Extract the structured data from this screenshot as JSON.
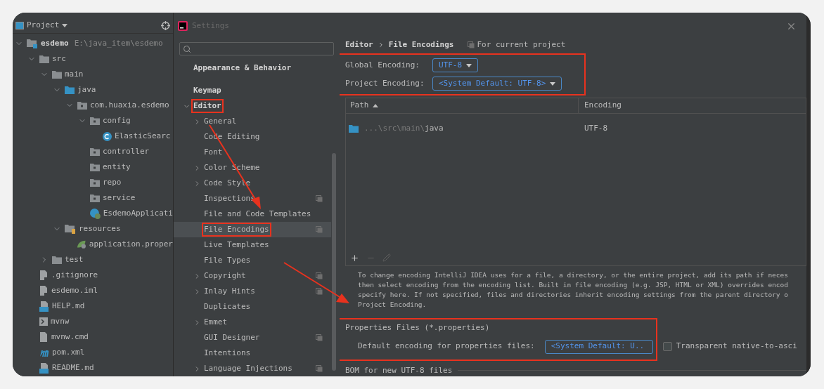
{
  "project_panel": {
    "title": "Project",
    "tree": [
      {
        "label": "esdemo",
        "kind": "module",
        "path": "E:\\java_item\\esdemo",
        "expanded": true,
        "children": [
          {
            "label": "src",
            "kind": "folder",
            "expanded": true,
            "children": [
              {
                "label": "main",
                "kind": "folder",
                "expanded": true,
                "children": [
                  {
                    "label": "java",
                    "kind": "source",
                    "expanded": true,
                    "children": [
                      {
                        "label": "com.huaxia.esdemo",
                        "kind": "package",
                        "expanded": true,
                        "children": [
                          {
                            "label": "config",
                            "kind": "package",
                            "expanded": true,
                            "children": [
                              {
                                "label": "ElasticSearc",
                                "kind": "class"
                              }
                            ]
                          },
                          {
                            "label": "controller",
                            "kind": "package"
                          },
                          {
                            "label": "entity",
                            "kind": "package"
                          },
                          {
                            "label": "repo",
                            "kind": "package"
                          },
                          {
                            "label": "service",
                            "kind": "package"
                          },
                          {
                            "label": "EsdemoApplicati",
                            "kind": "app-class"
                          }
                        ]
                      }
                    ]
                  },
                  {
                    "label": "resources",
                    "kind": "resources",
                    "expanded": true,
                    "children": [
                      {
                        "label": "application.proper",
                        "kind": "properties"
                      }
                    ]
                  }
                ]
              },
              {
                "label": "test",
                "kind": "folder",
                "expanded": false
              }
            ]
          },
          {
            "label": ".gitignore",
            "kind": "ignore"
          },
          {
            "label": "esdemo.iml",
            "kind": "iml"
          },
          {
            "label": "HELP.md",
            "kind": "markdown"
          },
          {
            "label": "mvnw",
            "kind": "shell"
          },
          {
            "label": "mvnw.cmd",
            "kind": "text"
          },
          {
            "label": "pom.xml",
            "kind": "maven"
          },
          {
            "label": "README.md",
            "kind": "markdown"
          }
        ]
      }
    ]
  },
  "settings": {
    "title": "Settings",
    "nav": [
      {
        "label": "Appearance & Behavior",
        "expandable": false,
        "selected": false,
        "annotated": false
      },
      {
        "label": "Keymap",
        "expandable": false,
        "selected": false,
        "annotated": false
      },
      {
        "label": "Editor",
        "expandable": true,
        "expanded": true,
        "selected": false,
        "annotated": true,
        "children": [
          {
            "label": "General",
            "expandable": true,
            "project_scope": false,
            "selected": false,
            "annotated": false
          },
          {
            "label": "Code Editing",
            "expandable": false,
            "project_scope": false,
            "selected": false,
            "annotated": false
          },
          {
            "label": "Font",
            "expandable": false,
            "project_scope": false,
            "selected": false,
            "annotated": false
          },
          {
            "label": "Color Scheme",
            "expandable": true,
            "project_scope": false,
            "selected": false,
            "annotated": false
          },
          {
            "label": "Code Style",
            "expandable": true,
            "project_scope": false,
            "selected": false,
            "annotated": false
          },
          {
            "label": "Inspections",
            "expandable": false,
            "project_scope": true,
            "selected": false,
            "annotated": false
          },
          {
            "label": "File and Code Templates",
            "expandable": false,
            "project_scope": false,
            "selected": false,
            "annotated": false
          },
          {
            "label": "File Encodings",
            "expandable": false,
            "project_scope": true,
            "selected": true,
            "annotated": true
          },
          {
            "label": "Live Templates",
            "expandable": false,
            "project_scope": false,
            "selected": false,
            "annotated": false
          },
          {
            "label": "File Types",
            "expandable": false,
            "project_scope": false,
            "selected": false,
            "annotated": false
          },
          {
            "label": "Copyright",
            "expandable": true,
            "project_scope": true,
            "selected": false,
            "annotated": false
          },
          {
            "label": "Inlay Hints",
            "expandable": true,
            "project_scope": true,
            "selected": false,
            "annotated": false
          },
          {
            "label": "Duplicates",
            "expandable": false,
            "project_scope": false,
            "selected": false,
            "annotated": false
          },
          {
            "label": "Emmet",
            "expandable": true,
            "project_scope": false,
            "selected": false,
            "annotated": false
          },
          {
            "label": "GUI Designer",
            "expandable": false,
            "project_scope": true,
            "selected": false,
            "annotated": false
          },
          {
            "label": "Intentions",
            "expandable": false,
            "project_scope": false,
            "selected": false,
            "annotated": false
          },
          {
            "label": "Language Injections",
            "expandable": true,
            "project_scope": true,
            "selected": false,
            "annotated": false
          }
        ]
      }
    ],
    "breadcrumb": [
      "Editor",
      "File Encodings"
    ],
    "scope": "For current project",
    "encodings": {
      "annotated": true,
      "global_label": "Global Encoding:",
      "global_value": "UTF-8",
      "project_label": "Project Encoding:",
      "project_value": "<System Default: UTF-8>"
    },
    "table": {
      "columns": [
        {
          "label": "Path",
          "sorted_ascending": true
        },
        {
          "label": "Encoding"
        }
      ],
      "rows": [
        {
          "path_prefix": "...\\src\\main\\",
          "path_name": "java",
          "encoding": "UTF-8"
        }
      ]
    },
    "description": [
      "To change encoding IntelliJ IDEA uses for a file, a directory, or the entire project, add its path if neces",
      "then select encoding from the encoding list. Built in file encoding (e.g. JSP, HTML or XML) overrides encod",
      "specify here. If not specified, files and directories inherit encoding settings from the parent directory o",
      "Project Encoding."
    ],
    "properties": {
      "annotated": true,
      "title": "Properties Files (*.properties)",
      "label": "Default encoding for properties files:",
      "value": "<System Default: U..",
      "transparent_label": "Transparent native-to-asci",
      "transparent_checked": false
    },
    "bom_title": "BOM for new UTF-8 files"
  }
}
